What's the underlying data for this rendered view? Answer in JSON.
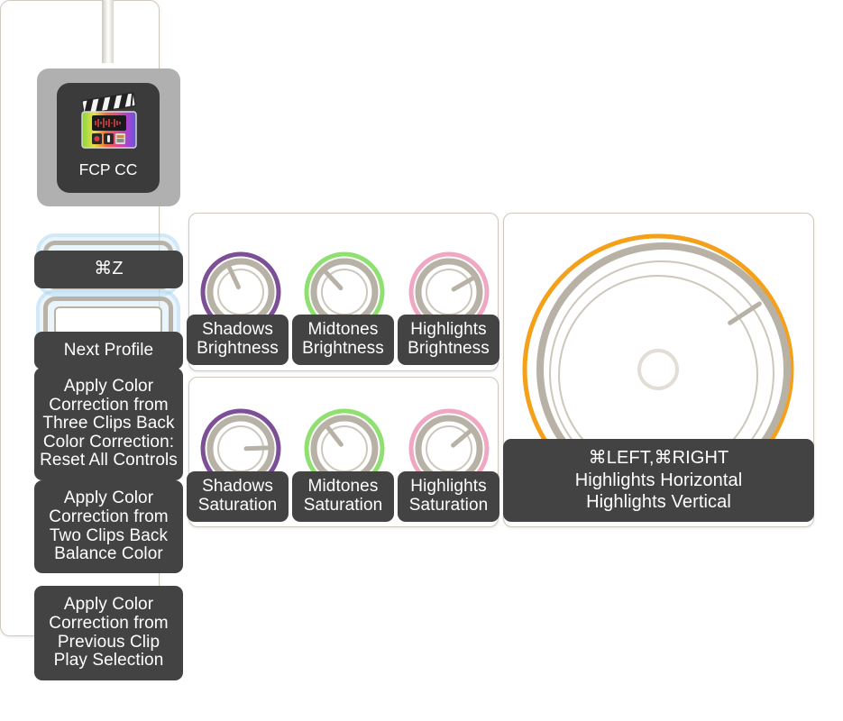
{
  "app": {
    "name": "FCP CC",
    "icon": "final-cut-pro-clapperboard-icon"
  },
  "sidebar": {
    "buttons": [
      {
        "label": "⌘Z",
        "name": "undo-shortcut"
      },
      {
        "label": "Next Profile",
        "name": "next-profile"
      }
    ],
    "rows": [
      {
        "name": "apply-color-correction-three-clips-back",
        "outline_color": "#6e1d1d",
        "lines": [
          "Apply Color",
          "Correction from",
          "Three Clips Back",
          "Color Correction:",
          "Reset All Controls"
        ]
      },
      {
        "name": "apply-color-correction-two-clips-back",
        "outline_color": "#0d4a14",
        "lines": [
          "Apply Color",
          "Correction from",
          "Two Clips Back",
          "Balance Color"
        ]
      },
      {
        "name": "apply-color-correction-previous-clip",
        "outline_color": "#101a5c",
        "lines": [
          "Apply Color",
          "Correction from",
          "Previous Clip",
          "Play Selection"
        ]
      }
    ]
  },
  "brightness_panel": {
    "knobs": [
      {
        "name": "shadows-brightness",
        "ring_color": "#7d4f96",
        "angle": -115,
        "lines": [
          "Shadows",
          "Brightness"
        ]
      },
      {
        "name": "midtones-brightness",
        "ring_color": "#90e071",
        "angle": -133,
        "lines": [
          "Midtones",
          "Brightness"
        ]
      },
      {
        "name": "highlights-brightness",
        "ring_color": "#f0a8c2",
        "angle": -30,
        "lines": [
          "Highlights",
          "Brightness"
        ]
      }
    ]
  },
  "saturation_panel": {
    "knobs": [
      {
        "name": "shadows-saturation",
        "ring_color": "#7d4f96",
        "angle": -2,
        "lines": [
          "Shadows",
          "Saturation"
        ]
      },
      {
        "name": "midtones-saturation",
        "ring_color": "#90e071",
        "angle": -128,
        "lines": [
          "Midtones",
          "Saturation"
        ]
      },
      {
        "name": "highlights-saturation",
        "ring_color": "#f0a8c2",
        "angle": -40,
        "lines": [
          "Highlights",
          "Saturation"
        ]
      }
    ]
  },
  "wheel_panel": {
    "name": "highlights-color-wheel",
    "ring_color": "#f5a01a",
    "angle": -33,
    "lines": [
      "⌘LEFT,⌘RIGHT",
      "Highlights Horizontal",
      "Highlights Vertical"
    ]
  },
  "colors": {
    "panel_border": "#cfc9be",
    "plate_bg": "#434343",
    "dial_gray": "#b7b1a6",
    "app_tile": "#b0b0b0"
  }
}
